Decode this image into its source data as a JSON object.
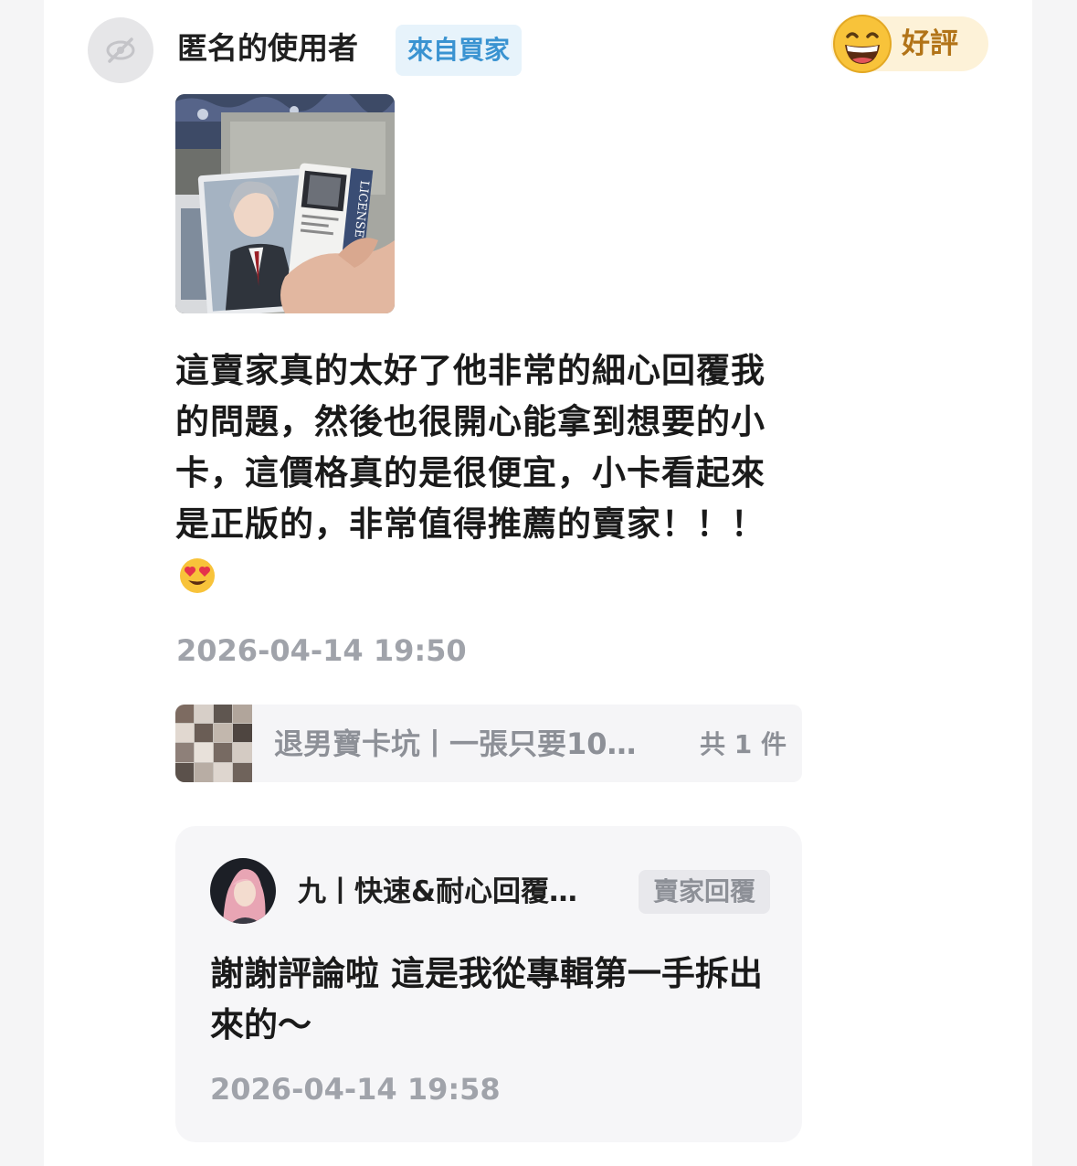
{
  "review": {
    "username": "匿名的使用者",
    "buyer_badge": "來自買家",
    "rating_label": "好評",
    "text": "這賣家真的太好了他非常的細心回覆我的問題，然後也很開心能拿到想要的小卡，這價格真的是很便宜，小卡看起來是正版的，非常值得推薦的賣家！！！",
    "time": "2026-04-14 19:50"
  },
  "product": {
    "name": "退男寶卡坑丨一張只要10…",
    "count": "共 1 件"
  },
  "reply": {
    "seller_name": "九丨快速&耐心回覆…",
    "badge": "賣家回覆",
    "text": "謝謝評論啦 這是我從專輯第一手拆出來的～",
    "time": "2026-04-14 19:58"
  },
  "icons": {
    "anonymous_avatar": "hidden-eye-icon",
    "rating": "grinning-face-icon",
    "heart_eyes": "heart-eyes-emoji-icon"
  },
  "colors": {
    "buyer_badge_text": "#3a93d1",
    "buyer_badge_bg": "#e7f3fb",
    "rating_text": "#b27418",
    "rating_bg": "#fdf2d8",
    "muted_text": "#a0a3aa"
  }
}
